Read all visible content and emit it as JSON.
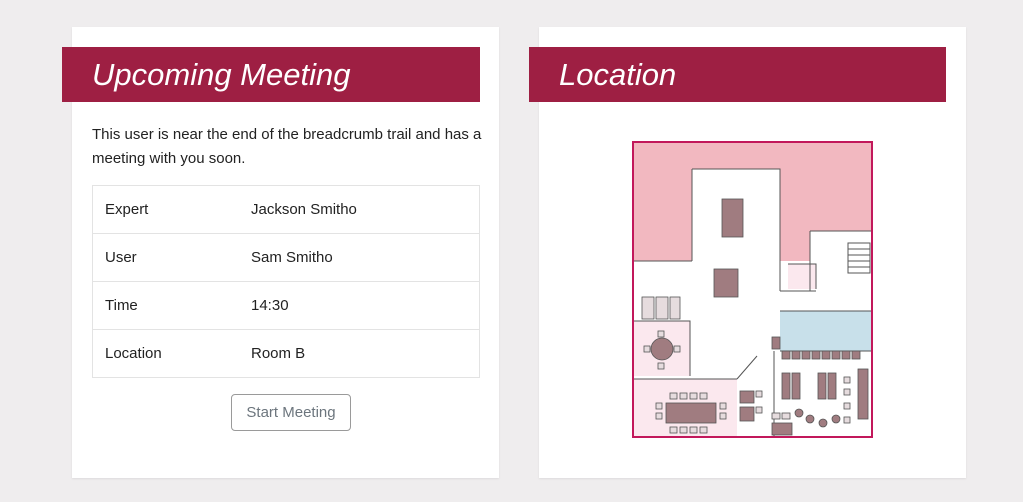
{
  "meeting": {
    "title": "Upcoming Meeting",
    "description": "This user is near the end of the breadcrumb trail and has a meeting with you soon.",
    "rows": [
      {
        "label": "Expert",
        "value": "Jackson Smitho"
      },
      {
        "label": "User",
        "value": "Sam Smitho"
      },
      {
        "label": "Time",
        "value": "14:30"
      },
      {
        "label": "Location",
        "value": "Room B"
      }
    ],
    "start_button": "Start Meeting"
  },
  "location": {
    "title": "Location",
    "map_icon": "floor-plan-map"
  },
  "colors": {
    "brand": "#9e1f43",
    "map_pink": "#f2b8c0",
    "map_light_pink": "#fbe8ee",
    "map_blue": "#c8e0ea",
    "furniture": "#a07c80"
  }
}
